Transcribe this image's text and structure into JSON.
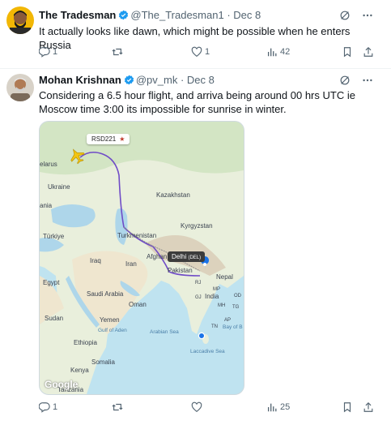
{
  "tweet1": {
    "name": "The Tradesman",
    "handle": "@The_Tradesman1",
    "date": "· Dec 8",
    "text": "It actually looks like dawn, which might be possible when he enters Russia",
    "replies": "1",
    "retweets": "",
    "likes": "1",
    "views": "42"
  },
  "tweet2": {
    "name": "Mohan Krishnan",
    "handle": "@pv_mk",
    "date": "· Dec 8",
    "text": "Considering a 6.5 hour flight, and arriva being around 00 hrs UTC ie Moscow time 3:00 its impossible for sunrise in winter.",
    "replies": "1",
    "retweets": "",
    "likes": "",
    "views": "25"
  },
  "map": {
    "flight_label": "RSD221",
    "flight_star": "★",
    "delhi_label": "Delhi",
    "delhi_code": "(DEL)",
    "google": "Google",
    "labels": {
      "belarus": "elarus",
      "ukraine": "Ukraine",
      "kazakhstan": "Kazakhstan",
      "kyrgyzstan": "Kyrgyzstan",
      "turkmenistan": "Turkmenistan",
      "turkiye": "Türkiye",
      "iraq": "Iraq",
      "iran": "Iran",
      "afghanistan": "Afghan",
      "pakistan": "Pakistan",
      "nepal": "Nepal",
      "egypt": "Egypt",
      "saudi": "Saudi Arabia",
      "oman": "Oman",
      "india": "India",
      "sudan": "Sudan",
      "yemen": "Yemen",
      "ethiopia": "Ethiopia",
      "somalia": "Somalia",
      "kenya": "Kenya",
      "tanzania": "Tanzania",
      "rania": "ania",
      "arabian_sea": "Arabian Sea",
      "bay_of_bengal": "Bay of B",
      "gulf_of_aden": "Gulf of Aden",
      "laccadive": "Laccadive Sea",
      "mh": "MH",
      "ap": "AP",
      "tn": "TN",
      "tg": "TG",
      "gj": "GJ",
      "rj": "RJ",
      "mp": "MP",
      "od": "OD"
    }
  },
  "colors": {
    "accent": "#1d9bf0",
    "flight_path": "#6f4bc7",
    "muted": "#536471"
  }
}
